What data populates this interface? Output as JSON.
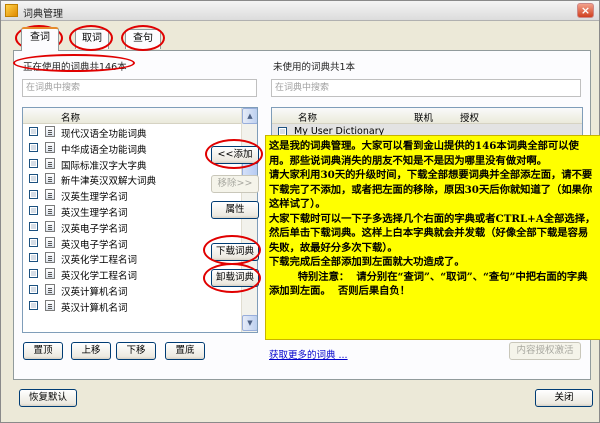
{
  "window": {
    "title": "词典管理"
  },
  "tabs": [
    {
      "label": "查词",
      "active": true
    },
    {
      "label": "取词",
      "active": false
    },
    {
      "label": "查句",
      "active": false
    }
  ],
  "left": {
    "count_label": "正在使用的词典共146本",
    "search_placeholder": "在词典中搜索",
    "column_name": "名称",
    "items": [
      "现代汉语全功能词典",
      "中华成语全功能词典",
      "国际标准汉字大字典",
      "新牛津英汉双解大词典",
      "汉英生理学名词",
      "英汉生理学名词",
      "汉英电子学名词",
      "英汉电子学名词",
      "汉英化学工程名词",
      "英汉化学工程名词",
      "汉英计算机名词",
      "英汉计算机名词"
    ],
    "buttons": {
      "top": "置顶",
      "up": "上移",
      "down": "下移",
      "bottom": "置底"
    }
  },
  "middle_buttons": {
    "add": "<<添加",
    "remove": "移除>>",
    "properties": "属性",
    "download": "下载词典",
    "uninstall": "卸载词典"
  },
  "right": {
    "count_label": "未使用的词典共1本",
    "search_placeholder": "在词典中搜索",
    "columns": {
      "name": "名称",
      "online": "联机",
      "license": "授权"
    },
    "items": [
      "My User Dictionary"
    ],
    "more_link": "获取更多的词典 ...",
    "activate_button": "内容授权激活"
  },
  "annotation": {
    "text": "这是我的词典管理。大家可以看到金山提供的146本词典全部可以使用。那些说词典消失的朋友不知是不是因为哪里没有做对啊。\n请大家利用30天的升级时间，下载全部想要词典并全部添左面，请不要下载完了不添加，或者把左面的移除，原因30天后你就知道了（如果你这样试了）。\n大家下载时可以一下子多选择几个右面的字典或者CTRL+A全部选择，然后单击下载词典。这样上白本字典就会并发载（好像全部下载是容易失败，故最好分多次下载）。\n下载完成后全部添加到左面就大功造成了。\n        特别注意：  请分别在“查词”、“取词”、“查句”中把右面的字典添加到左面。  否则后果自负！"
  },
  "footer": {
    "restore_default": "恢复默认",
    "close": "关闭"
  },
  "colors": {
    "highlight": "#ffff00",
    "ring": "#e00000",
    "link": "#0000cc"
  }
}
